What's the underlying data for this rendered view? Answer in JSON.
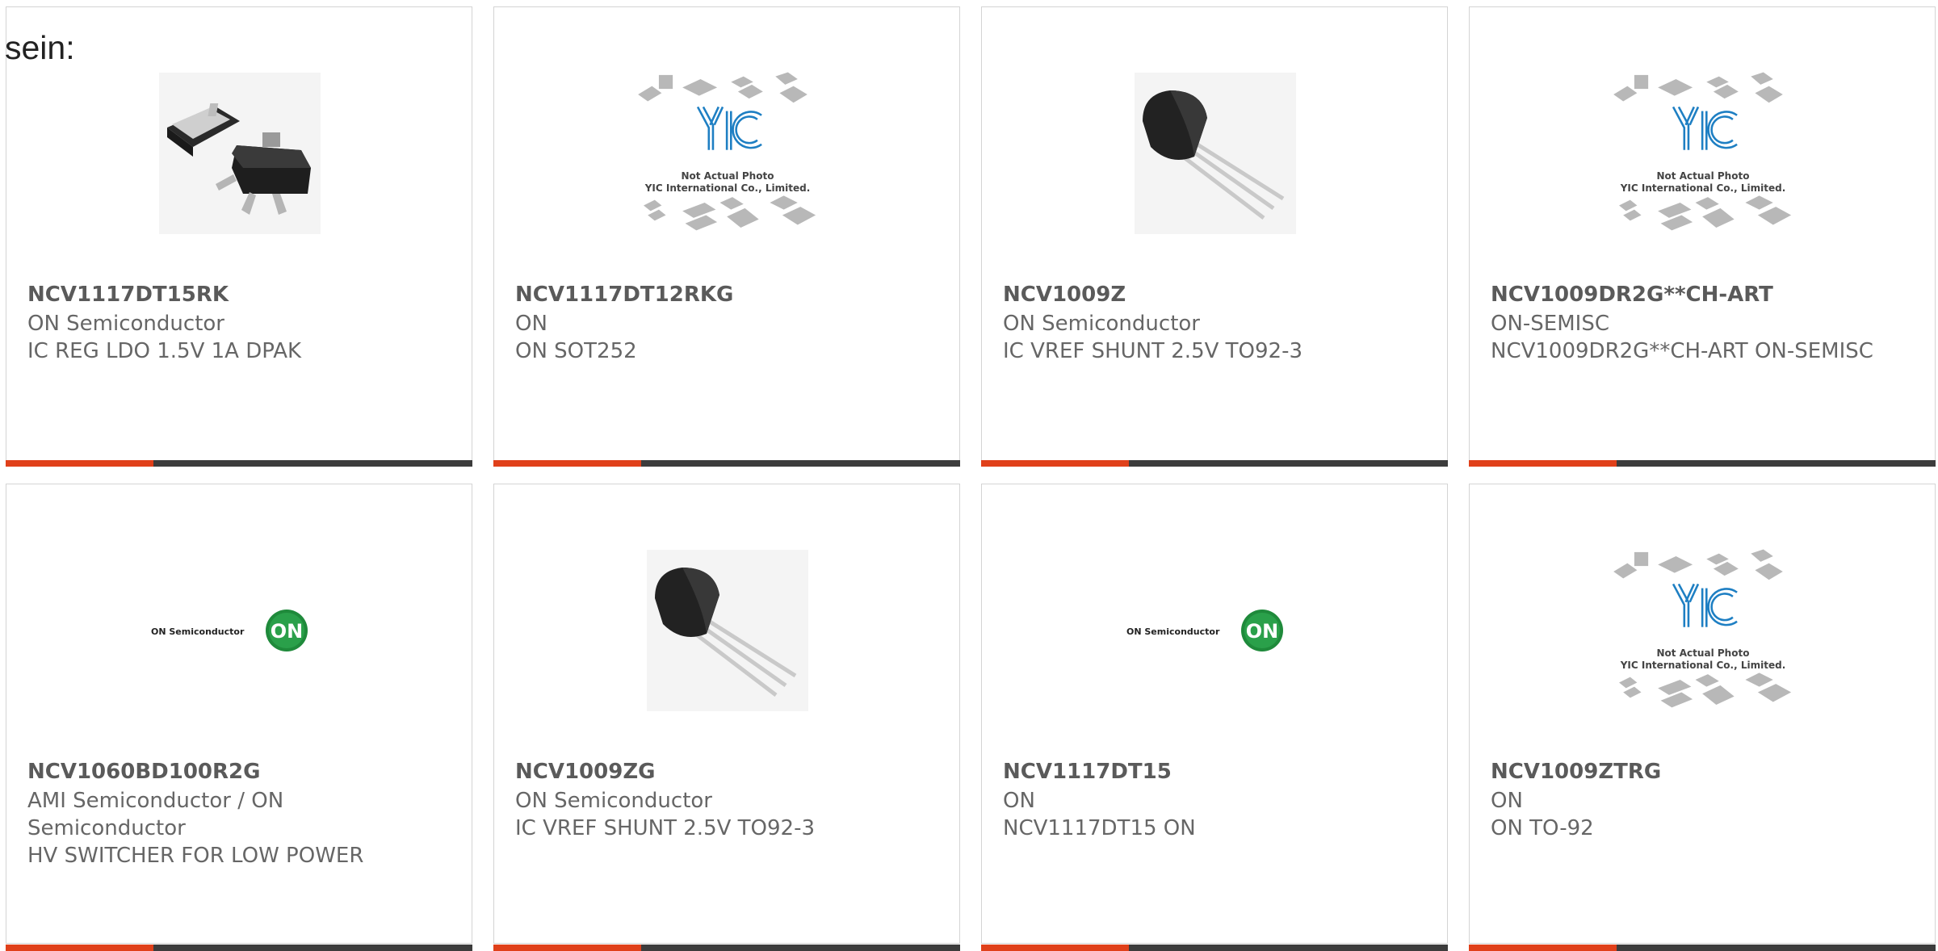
{
  "intro_text": "sein:",
  "placeholder_caption": {
    "line1": "Not Actual Photo",
    "line2": "YIC International Co., Limited."
  },
  "logo_text": {
    "brand": "ON Semiconductor",
    "badge": "ON"
  },
  "colors": {
    "accent": "#e0401a",
    "bar": "#3c3c3c",
    "logo_green": "#1f8a3b",
    "yic_blue": "#1e7fc3"
  },
  "products": [
    {
      "part": "NCV1117DT15RK",
      "brand": "ON Semiconductor",
      "desc": "IC REG LDO 1.5V 1A DPAK",
      "image": "dpak-package"
    },
    {
      "part": "NCV1117DT12RKG",
      "brand": "ON",
      "desc": "ON SOT252",
      "image": "yic-placeholder"
    },
    {
      "part": "NCV1009Z",
      "brand": "ON Semiconductor",
      "desc": "IC VREF SHUNT 2.5V TO92-3",
      "image": "to92-package"
    },
    {
      "part": "NCV1009DR2G**CH-ART",
      "brand": "ON-SEMISC",
      "desc": "NCV1009DR2G**CH-ART ON-SEMISC",
      "image": "yic-placeholder"
    },
    {
      "part": "NCV1060BD100R2G",
      "brand": "AMI Semiconductor / ON Semiconductor",
      "desc": "HV SWITCHER FOR LOW POWER",
      "image": "on-logo"
    },
    {
      "part": "NCV1009ZG",
      "brand": "ON Semiconductor",
      "desc": "IC VREF SHUNT 2.5V TO92-3",
      "image": "to92-package"
    },
    {
      "part": "NCV1117DT15",
      "brand": "ON",
      "desc": "NCV1117DT15 ON",
      "image": "on-logo"
    },
    {
      "part": "NCV1009ZTRG",
      "brand": "ON",
      "desc": "ON TO-92",
      "image": "yic-placeholder"
    }
  ]
}
